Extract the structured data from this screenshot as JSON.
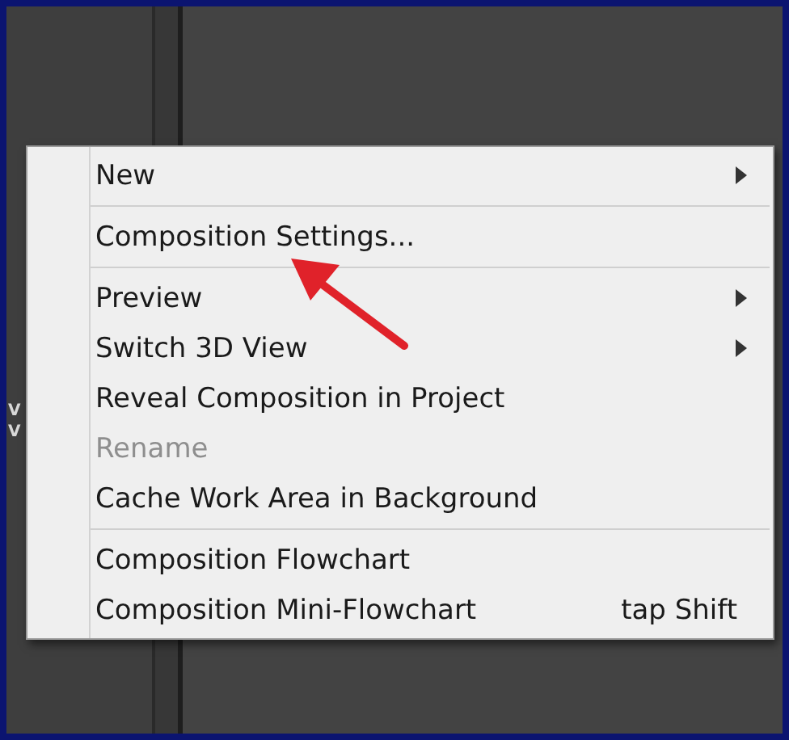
{
  "side_labels": [
    "V",
    "V"
  ],
  "menu": {
    "items": [
      {
        "kind": "item",
        "label": "New",
        "submenu": true,
        "disabled": false
      },
      {
        "kind": "separator"
      },
      {
        "kind": "item",
        "label": "Composition Settings...",
        "submenu": false,
        "disabled": false
      },
      {
        "kind": "separator"
      },
      {
        "kind": "item",
        "label": "Preview",
        "submenu": true,
        "disabled": false
      },
      {
        "kind": "item",
        "label": "Switch 3D View",
        "submenu": true,
        "disabled": false
      },
      {
        "kind": "item",
        "label": "Reveal Composition in Project",
        "submenu": false,
        "disabled": false
      },
      {
        "kind": "item",
        "label": "Rename",
        "submenu": false,
        "disabled": true
      },
      {
        "kind": "item",
        "label": "Cache Work Area in Background",
        "submenu": false,
        "disabled": false
      },
      {
        "kind": "separator"
      },
      {
        "kind": "item",
        "label": "Composition Flowchart",
        "submenu": false,
        "disabled": false
      },
      {
        "kind": "item",
        "label": "Composition Mini-Flowchart",
        "submenu": false,
        "disabled": false,
        "shortcut": "tap Shift"
      }
    ]
  }
}
